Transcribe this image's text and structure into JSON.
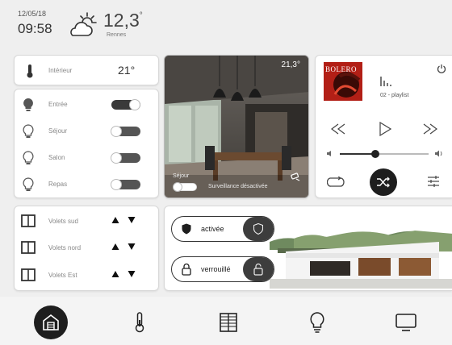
{
  "header": {
    "date": "12/05/18",
    "time": "09:58",
    "temperature": "12,3",
    "temperature_unit": "°",
    "city": "Rennes",
    "weather_icon": "sun-cloud-icon"
  },
  "climate": {
    "label": "Intérieur",
    "value": "21°",
    "icon": "thermometer-icon"
  },
  "lights": [
    {
      "label": "Entrée",
      "on": true
    },
    {
      "label": "Séjour",
      "on": false
    },
    {
      "label": "Salon",
      "on": false
    },
    {
      "label": "Repas",
      "on": false
    }
  ],
  "camera": {
    "temperature": "21,3°",
    "room": "Séjour",
    "surveillance_label": "Surveillance désactivée",
    "surveillance_on": false
  },
  "media": {
    "album_title": "BOLERO",
    "track": "02 - playlist",
    "volume": 0.4,
    "accent": "#c0281e"
  },
  "shutters": [
    {
      "label": "Volets sud"
    },
    {
      "label": "Volets nord"
    },
    {
      "label": "Volets Est"
    }
  ],
  "security": {
    "alarm_label": "activée",
    "lock_label": "verrouillé"
  },
  "nav": {
    "items": [
      "home-icon",
      "thermometer-icon",
      "shutters-icon",
      "lightbulb-icon",
      "monitor-icon"
    ],
    "active": "home-icon"
  }
}
